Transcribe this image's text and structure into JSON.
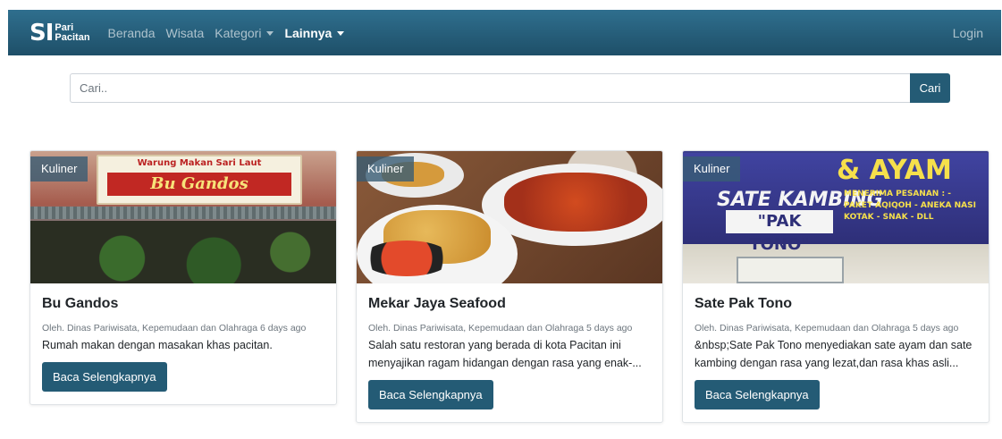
{
  "navbar": {
    "brand_mark": "SI",
    "brand_line1": "Pari",
    "brand_line2": "Pacitan",
    "links": [
      {
        "label": "Beranda"
      },
      {
        "label": "Wisata"
      },
      {
        "label": "Kategori"
      },
      {
        "label": "Lainnya"
      }
    ],
    "login": "Login"
  },
  "search": {
    "placeholder": "Cari..",
    "button": "Cari"
  },
  "cards": [
    {
      "badge": "Kuliner",
      "title": "Bu Gandos",
      "meta": "Oleh. Dinas Pariwisata, Kepemudaan dan Olahraga 6 days ago",
      "text": "Rumah makan dengan masakan khas pacitan.",
      "button": "Baca Selengkapnya",
      "image_sign_top": "Warung Makan Sari Laut",
      "image_sign_main": "Bu Gandos"
    },
    {
      "badge": "Kuliner",
      "title": "Mekar Jaya Seafood",
      "meta": "Oleh. Dinas Pariwisata, Kepemudaan dan Olahraga 5 days ago",
      "text": "Salah satu restoran yang berada di kota Pacitan ini menyajikan ragam hidangan dengan rasa yang enak-...",
      "button": "Baca Selengkapnya"
    },
    {
      "badge": "Kuliner",
      "title": "Sate Pak Tono",
      "meta": "Oleh. Dinas Pariwisata, Kepemudaan dan Olahraga 5 days ago",
      "text": "&nbsp;Sate Pak Tono menyediakan sate ayam dan sate kambing dengan rasa yang lezat,dan rasa khas asli...",
      "button": "Baca Selengkapnya",
      "image_and": "& AYAM",
      "image_sate": "SATE KAMBING",
      "image_pak": "\"PAK TONO\"",
      "image_info": "MENERIMA PESANAN : - PAKET AQIQOH - ANEKA NASI KOTAK - SNAK - DLL"
    }
  ],
  "colors": {
    "navbar": "#245b75",
    "button": "#245b75",
    "badge": "#385c74"
  }
}
